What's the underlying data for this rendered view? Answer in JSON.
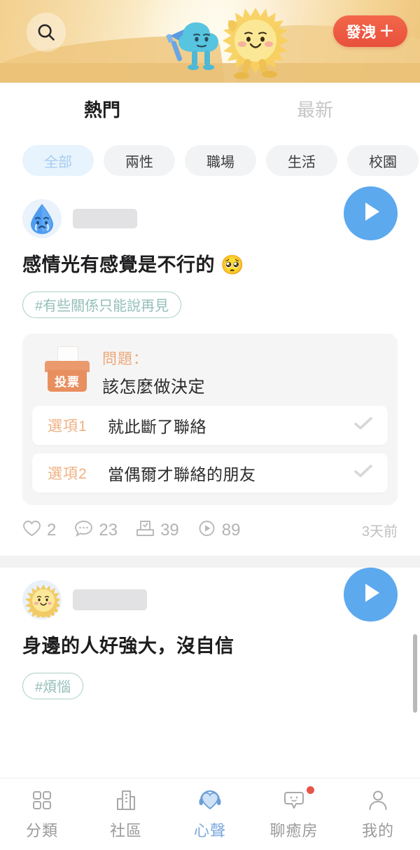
{
  "header": {
    "search_icon": "search-icon",
    "vent_button": {
      "label": "發洩",
      "plus": "＋"
    },
    "mascots": [
      "megaphone-cloud-mascot",
      "sun-mascot"
    ]
  },
  "tabs": [
    {
      "label": "熱門",
      "active": true
    },
    {
      "label": "最新",
      "active": false
    }
  ],
  "categories": [
    {
      "label": "全部",
      "active": true
    },
    {
      "label": "兩性",
      "active": false
    },
    {
      "label": "職場",
      "active": false
    },
    {
      "label": "生活",
      "active": false
    },
    {
      "label": "校園",
      "active": false
    }
  ],
  "posts": [
    {
      "avatar": "crying-teardrop-avatar",
      "username_redacted": true,
      "title": "感情光有感覺是不行的 🥺",
      "tag": "#有些關係只能說再見",
      "play_button": "play-icon",
      "poll": {
        "box_label": "投票",
        "question_label": "問題：",
        "question": "該怎麼做決定",
        "options": [
          {
            "index_label": "選項1",
            "text": "就此斷了聯絡"
          },
          {
            "index_label": "選項2",
            "text": "當偶爾才聯絡的朋友"
          }
        ]
      },
      "stats": [
        {
          "icon": "heart-icon",
          "value": "2"
        },
        {
          "icon": "comment-icon",
          "value": "23"
        },
        {
          "icon": "vote-box-icon",
          "value": "39"
        },
        {
          "icon": "play-circle-icon",
          "value": "89"
        }
      ],
      "time": "3天前"
    },
    {
      "avatar": "sun-avatar",
      "username_redacted": true,
      "title": "身邊的人好強大，沒自信",
      "tag": "#煩惱",
      "play_button": "play-icon"
    }
  ],
  "bottom_nav": [
    {
      "label": "分類",
      "icon": "grid-icon",
      "active": false,
      "badge": false
    },
    {
      "label": "社區",
      "icon": "buildings-icon",
      "active": false,
      "badge": false
    },
    {
      "label": "心聲",
      "icon": "heart-headphones-icon",
      "active": true,
      "badge": false
    },
    {
      "label": "聊癒房",
      "icon": "chat-bubble-icon",
      "active": false,
      "badge": true
    },
    {
      "label": "我的",
      "icon": "person-icon",
      "active": false,
      "badge": false
    }
  ],
  "colors": {
    "accent_red": "#e8503c",
    "accent_blue": "#5ca9ee",
    "nav_active": "#7ba7dd",
    "tag_green": "#94bfb8",
    "poll_orange": "#e88f5f",
    "badge_red": "#e8544a"
  }
}
